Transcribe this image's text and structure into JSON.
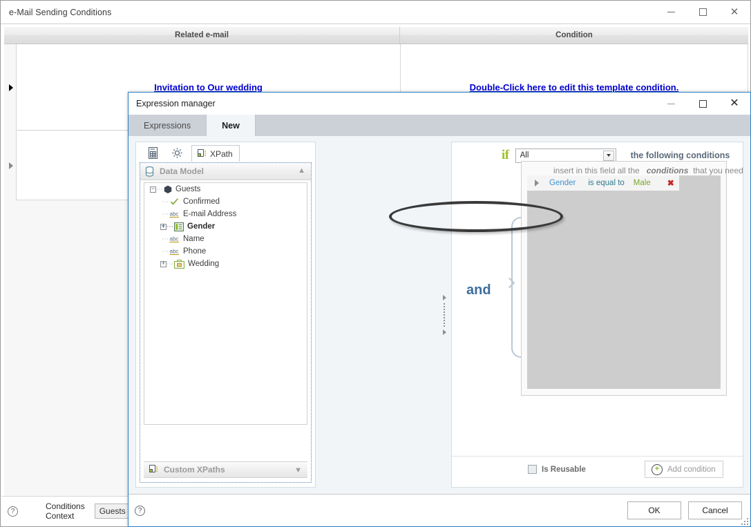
{
  "parent": {
    "title": "e-Mail Sending Conditions",
    "window_controls": {
      "minimize": "–",
      "maximize": "☐",
      "close": "✕"
    },
    "grid": {
      "columns": [
        "Related e-mail",
        "Condition"
      ],
      "rows": [
        {
          "related_email": "Invitation to Our wedding",
          "condition": "Double-Click here to edit this template condition."
        },
        {
          "related_email": "",
          "condition": ""
        }
      ]
    },
    "footer": {
      "help_icon": "?",
      "context_label_line1": "Conditions",
      "context_label_line2": "Context",
      "context_value": "Guests"
    }
  },
  "dialog": {
    "title": "Expression manager",
    "window_controls": {
      "minimize": "–",
      "maximize": "☐",
      "close": "✕"
    },
    "tabs": [
      {
        "label": "Expressions",
        "active": false
      },
      {
        "label": "New",
        "active": true
      }
    ],
    "left_panel": {
      "toolbar": {
        "xpath_tab_label": "XPath"
      },
      "data_model": {
        "header": "Data Model",
        "tree": [
          {
            "label": "Guests",
            "indent": 0,
            "icon": "node-icon",
            "toggle": "minus",
            "bold": false
          },
          {
            "label": "Confirmed",
            "indent": 1,
            "icon": "check-icon",
            "toggle": "none",
            "bold": false
          },
          {
            "label": "E-mail Address",
            "indent": 1,
            "icon": "abc-icon",
            "toggle": "none",
            "bold": false
          },
          {
            "label": "Gender",
            "indent": 1,
            "icon": "list-icon",
            "toggle": "plus",
            "bold": true
          },
          {
            "label": "Name",
            "indent": 1,
            "icon": "abc-icon",
            "toggle": "none",
            "bold": false
          },
          {
            "label": "Phone",
            "indent": 1,
            "icon": "abc-icon",
            "toggle": "none",
            "bold": false
          },
          {
            "label": "Wedding",
            "indent": 1,
            "icon": "folder-icon",
            "toggle": "plus",
            "bold": false
          }
        ]
      },
      "custom_xpaths": {
        "header": "Custom XPaths"
      }
    },
    "right_panel": {
      "if_word": "if",
      "match_select": {
        "value": "All"
      },
      "if_tail": "the following conditions",
      "operator_word": "and",
      "conditions_hint_part1": "insert in this field all the",
      "conditions_hint_emphasis": "conditions",
      "conditions_hint_part2": "that you need",
      "conditions": [
        {
          "field": "Gender",
          "operator": "is equal to",
          "value": "Male",
          "delete": "✖"
        }
      ],
      "is_reusable": {
        "label": "Is Reusable",
        "checked": false
      },
      "add_condition": {
        "label": "Add condition",
        "icon": "plus-circle-icon"
      }
    },
    "footer": {
      "help_icon": "?",
      "ok_label": "OK",
      "cancel_label": "Cancel"
    }
  },
  "colors": {
    "link": "#0000cd",
    "if_accent": "#9fbf2a",
    "and_accent": "#3d6d9e",
    "condition_field": "#3b93d4",
    "condition_operator": "#2f7a8f",
    "condition_value": "#7aa72c",
    "delete": "#c62828",
    "dialog_border": "#2b7ec1",
    "annotation": "#3a3a3a"
  }
}
